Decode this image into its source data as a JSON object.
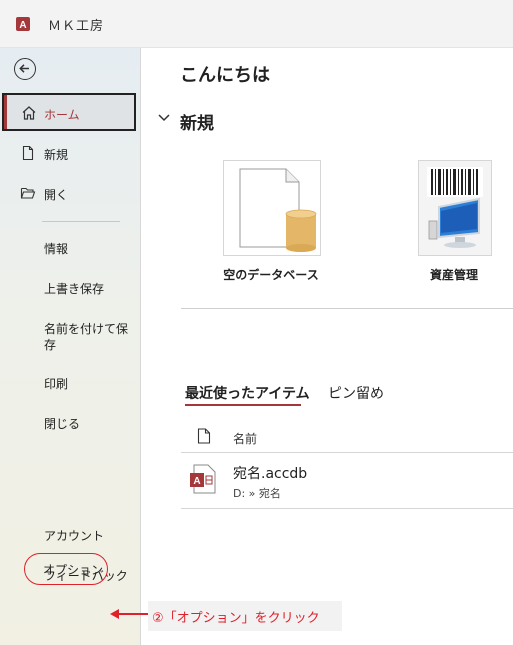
{
  "window": {
    "title": "ＭＫ工房",
    "app_icon": "access-icon",
    "accent": "#a4373a"
  },
  "sidebar": {
    "back_icon": "arrow-left-circle-icon",
    "home": {
      "label": "ホーム",
      "icon": "home-icon"
    },
    "new": {
      "label": "新規",
      "icon": "new-document-icon"
    },
    "open": {
      "label": "開く",
      "icon": "folder-open-icon"
    },
    "info": "情報",
    "save": "上書き保存",
    "save_as": "名前を付けて保存",
    "print": "印刷",
    "close": "閉じる",
    "account": "アカウント",
    "feedback": "フィードバック",
    "options": "オプション"
  },
  "main": {
    "greeting": "こんにちは",
    "new_section": "新規",
    "templates": [
      {
        "label": "空のデータベース",
        "icon": "blank-database-icon"
      },
      {
        "label": "資産管理",
        "icon": "asset-management-icon"
      }
    ],
    "tabs": {
      "recent": "最近使ったアイテム",
      "pinned": "ピン留め"
    },
    "list_header": {
      "name": "名前",
      "icon": "document-icon"
    },
    "files": [
      {
        "name": "宛名.accdb",
        "path": "D: » 宛名",
        "icon": "access-file-icon"
      }
    ]
  },
  "annotation": {
    "text": "②「オプション」をクリック",
    "color": "#e0202a"
  }
}
